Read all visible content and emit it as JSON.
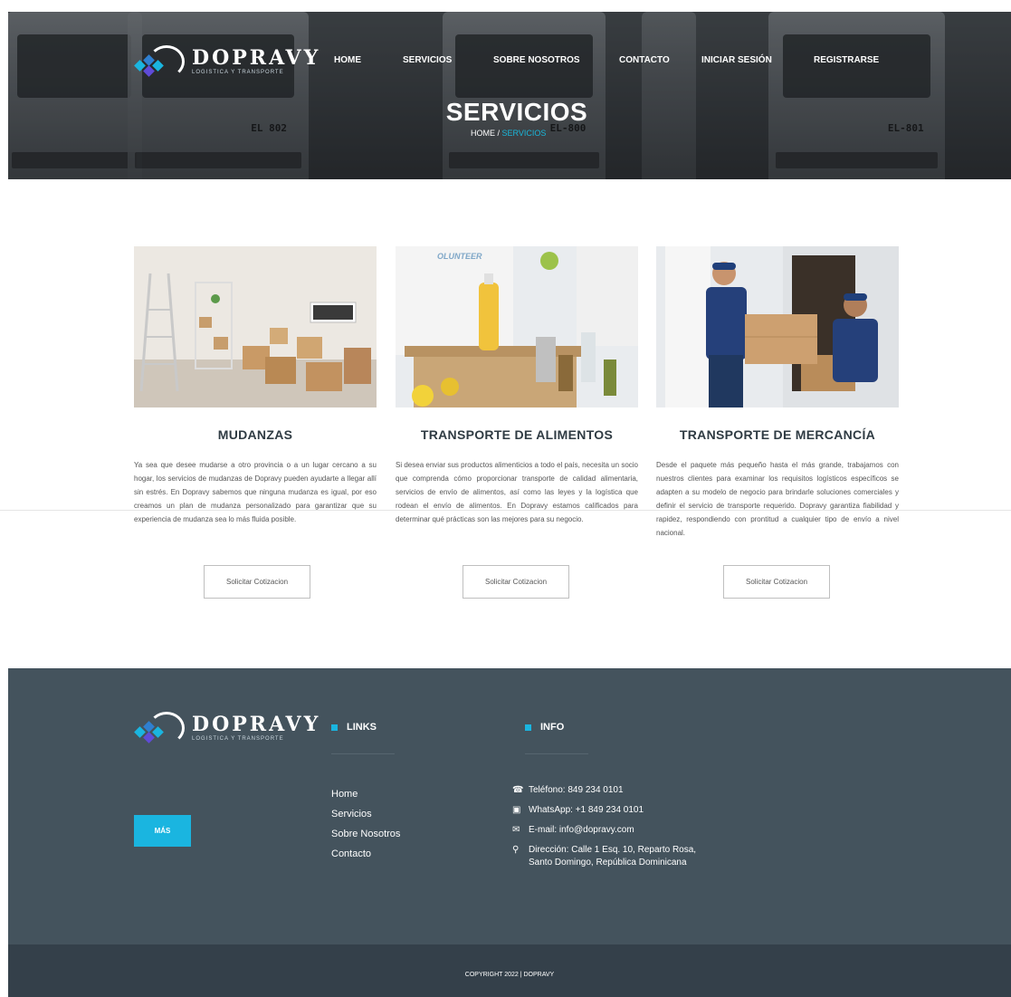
{
  "brand": {
    "name": "DOPRAVY",
    "tagline": "LOGISTICA Y TRANSPORTE",
    "colors": {
      "accent": "#1ab5e0",
      "footer": "#44535d",
      "copyright_bar": "#34404a"
    }
  },
  "nav": {
    "items": [
      "HOME",
      "SERVICIOS",
      "SOBRE NOSOTROS",
      "CONTACTO",
      "INICIAR SESIÓN",
      "REGISTRARSE"
    ]
  },
  "hero": {
    "title": "SERVICIOS",
    "breadcrumb_home": "HOME",
    "breadcrumb_sep": "/",
    "breadcrumb_current": "SERVICIOS",
    "truck_plates": [
      "EL 802",
      "EL-800",
      "EL-801"
    ]
  },
  "services": [
    {
      "title": "MUDANZAS",
      "text": "Ya sea que desee mudarse a otro provincia o a un lugar cercano a su hogar, los servicios de mudanzas de Dopravy pueden ayudarte a llegar allí sin estrés. En Dopravy sabemos que ninguna mudanza es igual, por eso creamos un plan de mudanza personalizado para garantizar que su experiencia de mudanza sea lo más fluida posible.",
      "button": "Solicitar Cotizacion",
      "image_icon": "moving-boxes-room-photo"
    },
    {
      "title": "TRANSPORTE DE ALIMENTOS",
      "text": "Si desea enviar sus productos alimenticios a todo el país, necesita un socio que comprenda cómo proporcionar transporte de calidad alimentaria, servicios de envío de alimentos, así como las leyes y la logística que rodean el envío de alimentos. En Dopravy estamos calificados para determinar qué prácticas son las mejores para su negocio.",
      "button": "Solicitar Cotizacion",
      "image_icon": "food-donation-photo",
      "image_text": "OLUNTEER"
    },
    {
      "title": "TRANSPORTE DE MERCANCÍA",
      "text": "Desde el paquete más pequeño hasta el más grande, trabajamos con nuestros clientes para examinar los requisitos logísticos específicos se adapten a su modelo de negocio para brindarle soluciones comerciales y definir el servicio de transporte requerido. Dopravy garantiza fiabilidad y rapidez, respondiendo con prontitud a cualquier tipo de envío a nivel nacional.",
      "button": "Solicitar Cotizacion",
      "image_icon": "delivery-workers-truck-photo"
    }
  ],
  "footer": {
    "more_button": "MÁS",
    "links_title": "LINKS",
    "links": [
      "Home",
      "Servicios",
      "Sobre Nosotros",
      "Contacto"
    ],
    "info_title": "INFO",
    "info": [
      {
        "icon": "phone-icon",
        "text": "Teléfono: 849 234 0101"
      },
      {
        "icon": "whatsapp-icon",
        "text": "WhatsApp: +1 849 234 0101"
      },
      {
        "icon": "envelope-icon",
        "text": "E-mail: info@dopravy.com"
      },
      {
        "icon": "map-pin-icon",
        "text": "Dirección: Calle 1 Esq. 10, Reparto Rosa, Santo Domingo, República Dominicana"
      }
    ],
    "copyright": "COPYRIGHT 2022 | DOPRAVY"
  }
}
